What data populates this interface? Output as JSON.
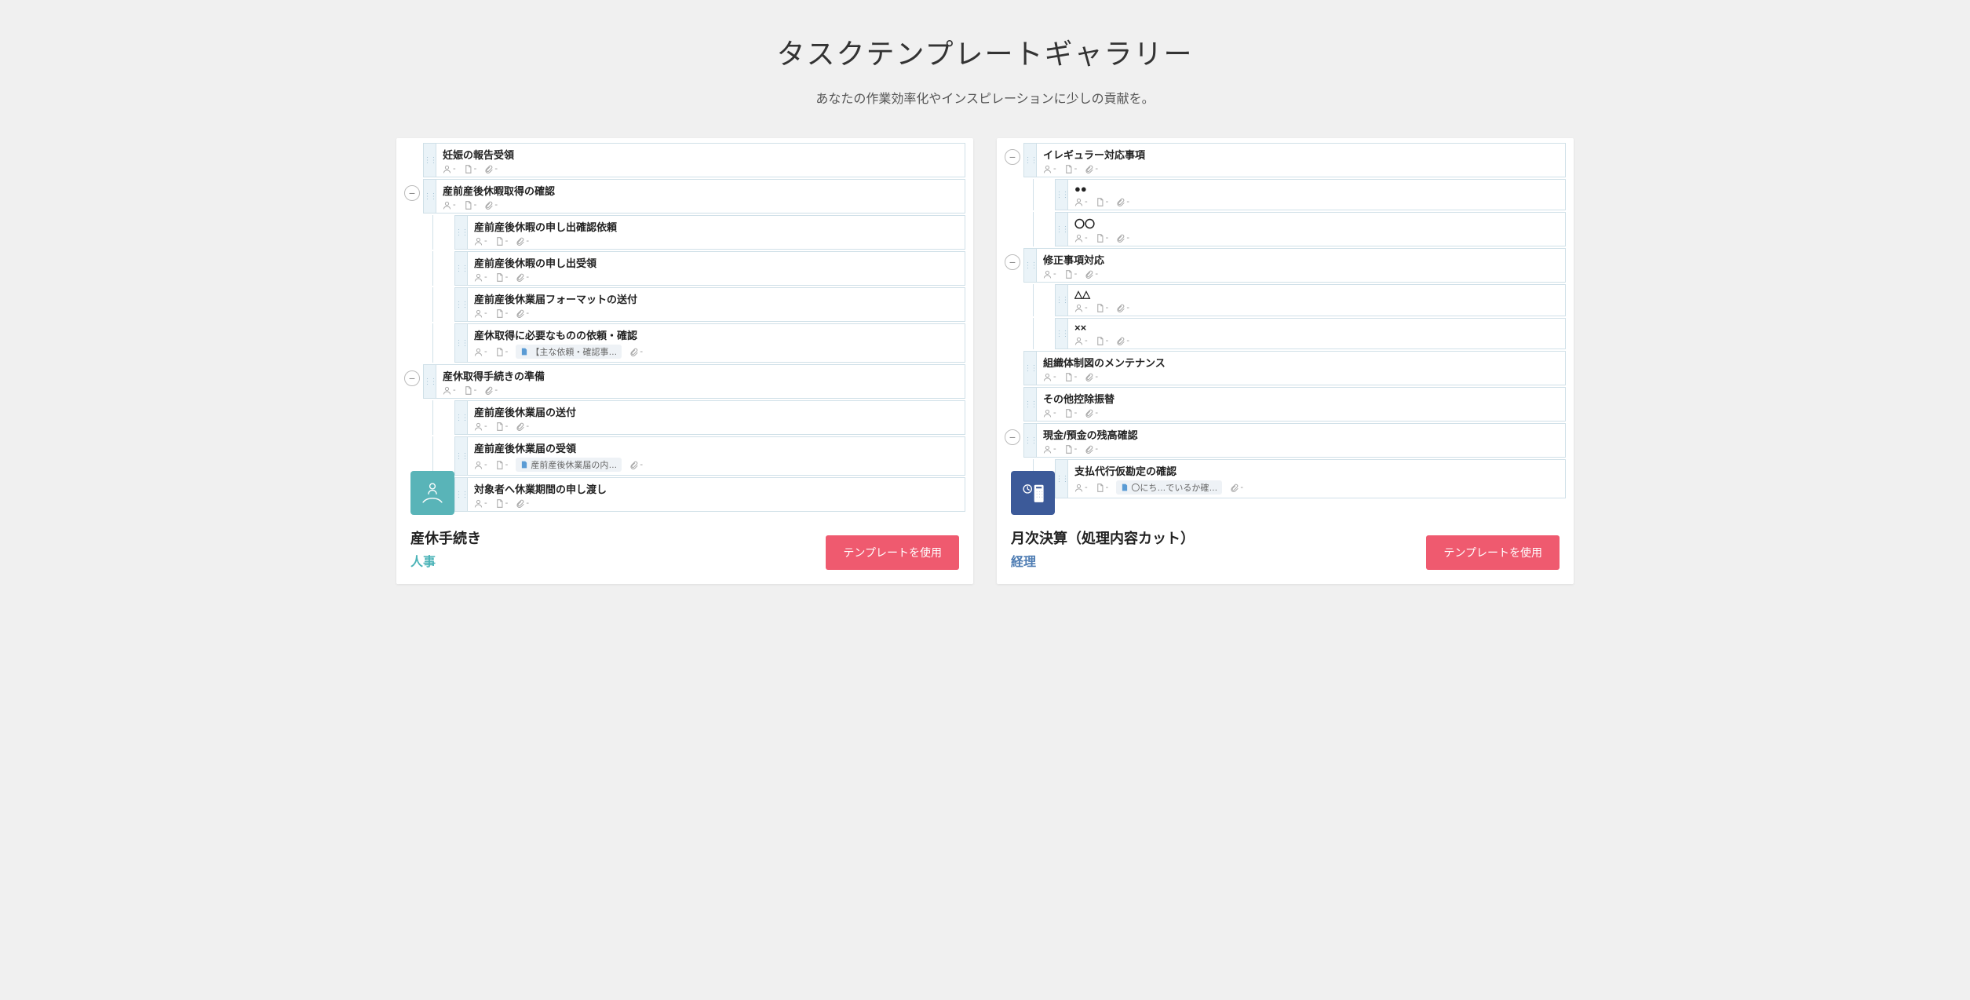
{
  "header": {
    "title": "タスクテンプレートギャラリー",
    "subtitle": "あなたの作業効率化やインスピレーションに少しの貢献を。"
  },
  "use_button_label": "テンプレートを使用",
  "cards": [
    {
      "title": "産休手続き",
      "category": "人事",
      "category_class": "cat-hr",
      "badge_class": "badge-hr",
      "badge_icon": "person-hand",
      "tasks": [
        {
          "level": 0,
          "collapse": false,
          "title": "妊娠の報告受領",
          "note": null
        },
        {
          "level": 0,
          "collapse": true,
          "title": "産前産後休暇取得の確認",
          "note": null
        },
        {
          "level": 1,
          "collapse": false,
          "title": "産前産後休暇の申し出確認依頼",
          "note": null
        },
        {
          "level": 1,
          "collapse": false,
          "title": "産前産後休暇の申し出受領",
          "note": null
        },
        {
          "level": 1,
          "collapse": false,
          "title": "産前産後休業届フォーマットの送付",
          "note": null
        },
        {
          "level": 1,
          "collapse": false,
          "title": "産休取得に必要なものの依頼・確認",
          "note": "【主な依頼・確認事…"
        },
        {
          "level": 0,
          "collapse": true,
          "title": "産休取得手続きの準備",
          "note": null
        },
        {
          "level": 1,
          "collapse": false,
          "title": "産前産後休業届の送付",
          "note": null
        },
        {
          "level": 1,
          "collapse": false,
          "title": "産前産後休業届の受領",
          "note": "産前産後休業届の内…"
        },
        {
          "level": 1,
          "collapse": false,
          "title": "対象者へ休業期間の申し渡し",
          "note": null
        }
      ]
    },
    {
      "title": "月次決算（処理内容カット）",
      "category": "経理",
      "category_class": "cat-acct",
      "badge_class": "badge-acct",
      "badge_icon": "calculator",
      "tasks": [
        {
          "level": 0,
          "collapse": true,
          "title": "イレギュラー対応事項",
          "note": null
        },
        {
          "level": 1,
          "collapse": false,
          "title": "●●",
          "note": null
        },
        {
          "level": 1,
          "collapse": false,
          "title": "〇〇",
          "note": null
        },
        {
          "level": 0,
          "collapse": true,
          "title": "修正事項対応",
          "note": null
        },
        {
          "level": 1,
          "collapse": false,
          "title": "△△",
          "note": null
        },
        {
          "level": 1,
          "collapse": false,
          "title": "××",
          "note": null
        },
        {
          "level": 0,
          "collapse": false,
          "title": "組織体制図のメンテナンス",
          "note": null
        },
        {
          "level": 0,
          "collapse": false,
          "title": "その他控除振替",
          "note": null
        },
        {
          "level": 0,
          "collapse": true,
          "title": "現金/預金の残高確認",
          "note": null
        },
        {
          "level": 1,
          "collapse": false,
          "title": "支払代行仮勘定の確認",
          "note": "〇にち…でいるか確…"
        }
      ]
    }
  ]
}
